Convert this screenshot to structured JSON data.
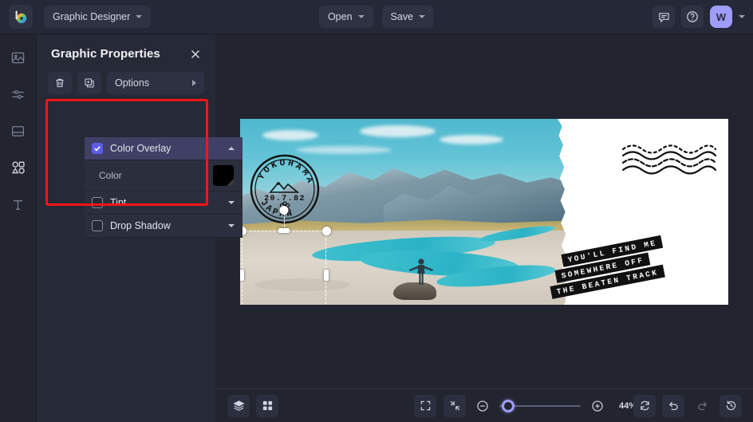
{
  "app": {
    "logo_icon": "befunky-color-wheel-logo",
    "document_name": "Graphic Designer",
    "open_label": "Open",
    "save_label": "Save",
    "comment_icon": "comment-icon",
    "help_icon": "help-circle-icon",
    "avatar_initial": "W",
    "accent_color": "#5b5ce8",
    "annotation_color": "#fa1515"
  },
  "rail": {
    "items": [
      {
        "name": "image-tool",
        "icon": "image-icon"
      },
      {
        "name": "adjust-tool",
        "icon": "sliders-icon"
      },
      {
        "name": "layout-tool",
        "icon": "layout-icon"
      },
      {
        "name": "graphics-tool",
        "icon": "shapes-icon"
      },
      {
        "name": "text-tool",
        "icon": "text-t-icon"
      }
    ]
  },
  "panel": {
    "title": "Graphic Properties",
    "close_icon": "close-x-icon",
    "delete_icon": "trash-icon",
    "duplicate_icon": "duplicate-icon",
    "options_label": "Options",
    "options_chevron": "chevron-right-icon",
    "effects": [
      {
        "label": "Color Overlay",
        "checked": true,
        "expanded": true,
        "chevron": "chevron-up-icon"
      },
      {
        "label": "Tint",
        "checked": false,
        "expanded": false,
        "chevron": "chevron-down-icon"
      },
      {
        "label": "Drop Shadow",
        "checked": false,
        "expanded": false,
        "chevron": "chevron-down-icon"
      }
    ],
    "color_label": "Color",
    "color_value": "#000000"
  },
  "canvas": {
    "stamp": {
      "top_text": "YOKOHAMA",
      "date_text": "20.7.82",
      "bottom_text": "JAPAN"
    },
    "postcard_lines": [
      "YOU'LL FIND ME",
      "SOMEWHERE OFF",
      "THE BEATEN TRACK"
    ]
  },
  "bottombar": {
    "layers_icon": "layers-icon",
    "grid_icon": "grid-icon",
    "fit_icon": "fit-screen-icon",
    "shrink_icon": "shrink-icon",
    "zoom_out_icon": "zoom-out-icon",
    "zoom_in_icon": "zoom-in-icon",
    "zoom_level": "44%",
    "reset_icon": "reset-rotate-icon",
    "undo_icon": "undo-icon",
    "redo_icon": "redo-icon",
    "history_icon": "history-clock-icon"
  }
}
